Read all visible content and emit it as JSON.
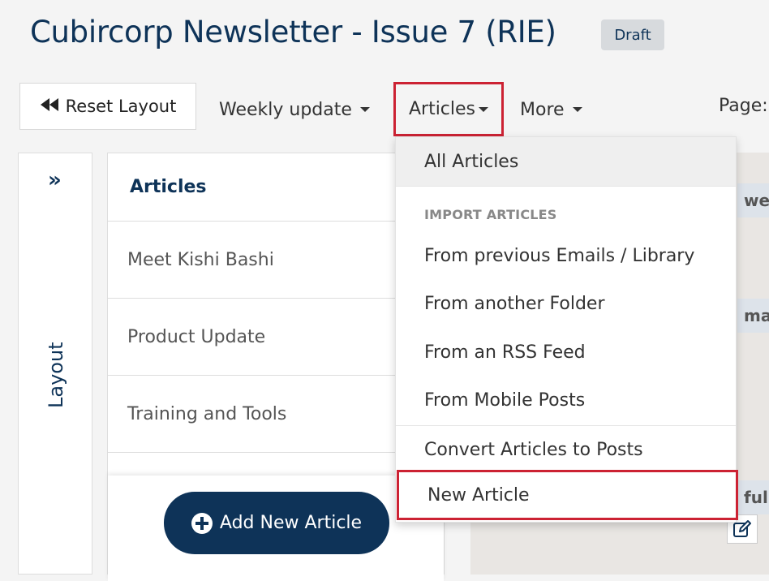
{
  "header": {
    "title": "Cubircorp Newsletter - Issue 7 (RIE)",
    "badge": "Draft"
  },
  "toolbar": {
    "reset_label": "Reset Layout",
    "weekly_label": "Weekly update",
    "articles_label": "Articles",
    "more_label": "More",
    "page_label": "Page:"
  },
  "rail": {
    "label": "Layout"
  },
  "articles_panel": {
    "heading": "Articles",
    "items": [
      "Meet Kishi Bashi",
      "Product Update",
      "Training and Tools"
    ],
    "add_label": "Add New Article"
  },
  "preview": {
    "strips": [
      "we",
      "ma",
      "ful"
    ]
  },
  "dropdown": {
    "all": "All Articles",
    "import_header": "IMPORT ARTICLES",
    "imports": [
      "From previous Emails / Library",
      "From another Folder",
      "From an RSS Feed",
      "From Mobile Posts"
    ],
    "convert": "Convert Articles to Posts",
    "new_article": "New Article"
  },
  "colors": {
    "brand": "#0e3358",
    "highlight": "#cc2233",
    "badge_bg": "#d7dadd"
  },
  "icons": {
    "reset": "rewind-icon",
    "rail": "double-chevron-right-icon",
    "add": "plus-circle-icon",
    "edit": "edit-icon"
  }
}
